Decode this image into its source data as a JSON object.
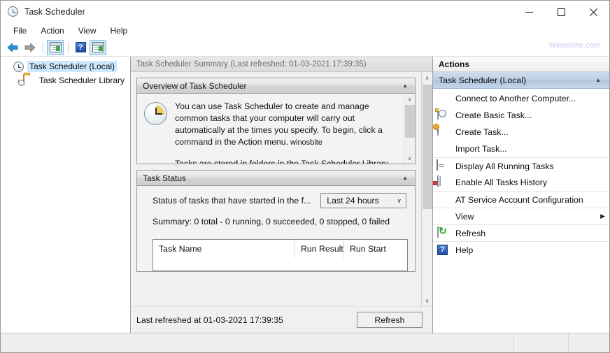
{
  "window": {
    "title": "Task Scheduler",
    "icon": "clock-icon",
    "minimize_label": "—",
    "maximize_label": "□",
    "close_label": "✕"
  },
  "menubar": {
    "items": [
      {
        "label": "File"
      },
      {
        "label": "Action"
      },
      {
        "label": "View"
      },
      {
        "label": "Help"
      }
    ]
  },
  "toolbar": {
    "watermark": "Winosbite.com",
    "buttons": [
      {
        "name": "back-button",
        "icon": "arrow-left-icon"
      },
      {
        "name": "forward-button",
        "icon": "arrow-right-icon"
      },
      {
        "name": "show-hide-console-tree-button",
        "icon": "window-pane-icon"
      },
      {
        "name": "help-button",
        "icon": "question-mark-icon"
      },
      {
        "name": "show-hide-action-pane-button",
        "icon": "window-pane-play-icon"
      }
    ]
  },
  "tree": {
    "items": [
      {
        "label": "Task Scheduler (Local)",
        "icon": "clock-icon",
        "selected": true,
        "expander": ""
      },
      {
        "label": "Task Scheduler Library",
        "icon": "folder-clock-icon",
        "selected": false,
        "expander": "›"
      }
    ]
  },
  "center": {
    "header": "Task Scheduler Summary (Last refreshed: 01-03-2021 17:39:35)",
    "overview": {
      "title": "Overview of Task Scheduler",
      "collapse_arrow": "▲",
      "icon": "clock-icon",
      "paragraph1": "You can use Task Scheduler to create and manage common tasks that your computer will carry out automatically at the times you specify. To begin, click a command in the Action menu.",
      "watermark_inline": " winosbite",
      "paragraph2": "Tasks are stored in folders in the Task Scheduler Library. To view or perform an operation on an individual task,"
    },
    "task_status": {
      "title": "Task Status",
      "collapse_arrow": "▲",
      "status_label": "Status of tasks that have started in the f...",
      "period_value": "Last 24 hours",
      "period_arrow": "∨",
      "summary": "Summary: 0 total - 0 running, 0 succeeded, 0 stopped, 0 failed",
      "columns": [
        "Task Name",
        "Run Result",
        "Run Start"
      ],
      "rows": []
    },
    "footer": {
      "last_refreshed": "Last refreshed at 01-03-2021 17:39:35",
      "refresh_button": "Refresh"
    },
    "scroll_up_arrow": "∧",
    "scroll_down_arrow": "∨"
  },
  "actions": {
    "header": "Actions",
    "group": {
      "title": "Task Scheduler (Local)",
      "collapse_arrow": "▲"
    },
    "items": [
      {
        "label": "Connect to Another Computer...",
        "icon": "none",
        "separator": false,
        "submenu": false
      },
      {
        "label": "Create Basic Task...",
        "icon": "doc-clock-icon",
        "separator": false,
        "submenu": false
      },
      {
        "label": "Create Task...",
        "icon": "clock-orange-icon",
        "separator": false,
        "submenu": false
      },
      {
        "label": "Import Task...",
        "icon": "none",
        "separator": false,
        "submenu": false
      },
      {
        "label": "Display All Running Tasks",
        "icon": "window-list-icon",
        "separator": true,
        "submenu": false
      },
      {
        "label": "Enable All Tasks History",
        "icon": "notebook-icon",
        "separator": false,
        "submenu": false
      },
      {
        "label": "AT Service Account Configuration",
        "icon": "none",
        "separator": true,
        "submenu": false
      },
      {
        "label": "View",
        "icon": "none",
        "separator": true,
        "submenu": true,
        "submenu_arrow": "▶"
      },
      {
        "label": "Refresh",
        "icon": "refresh-icon",
        "separator": true,
        "submenu": false
      },
      {
        "label": "Help",
        "icon": "help-icon",
        "separator": true,
        "submenu": false
      }
    ]
  },
  "statusbar": {
    "main": "",
    "cell2": "",
    "cell3": ""
  },
  "colors": {
    "selection_blue": "#cde8ff",
    "actions_group_blue": "#bccfe4",
    "watermark_purple": "#cfc4ef",
    "panel_gray": "#f0f0f0",
    "border_gray": "#9a9a9a"
  }
}
